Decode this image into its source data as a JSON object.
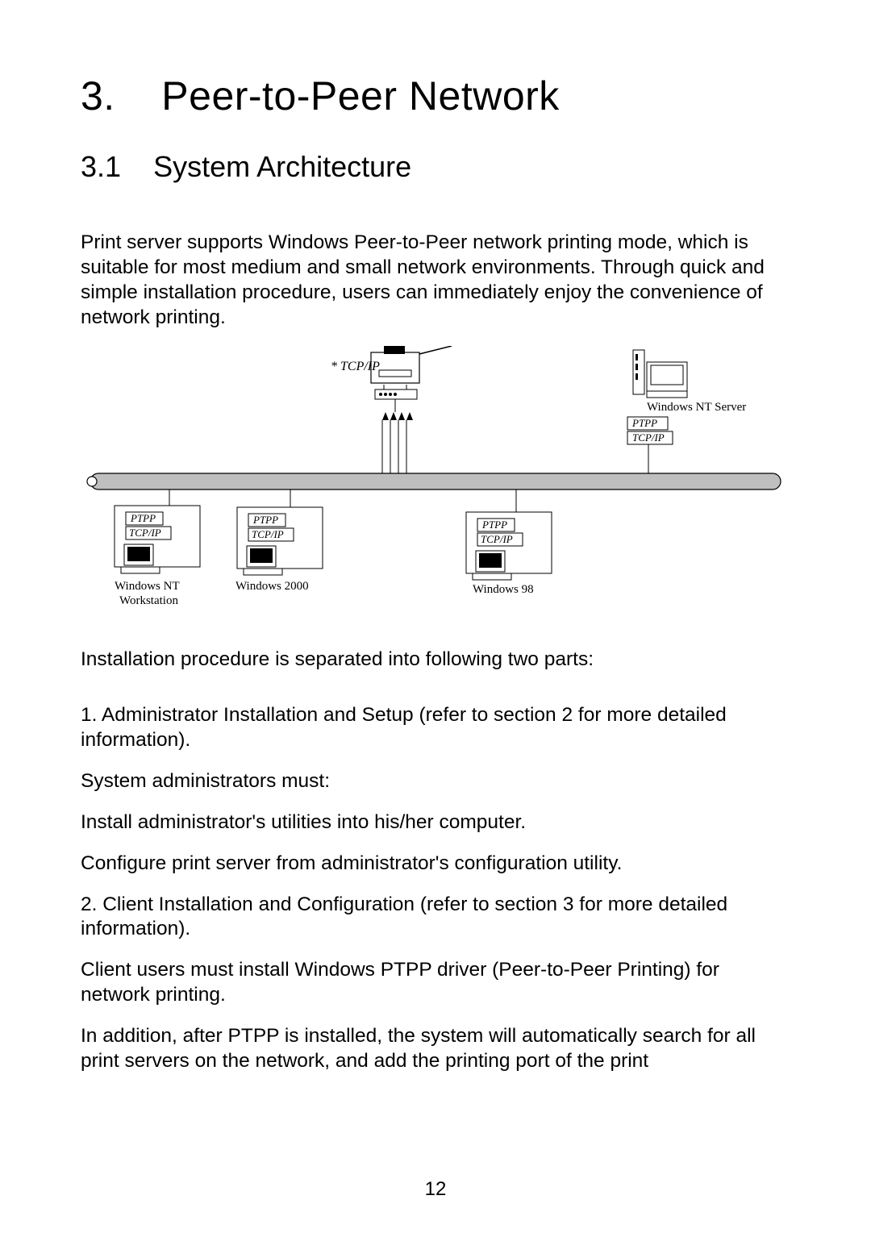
{
  "chapter": {
    "number": "3.",
    "title": "Peer-to-Peer Network"
  },
  "section": {
    "number": "3.1",
    "title": "System Architecture"
  },
  "paragraphs": {
    "intro": "Print server supports Windows Peer-to-Peer network printing mode, which is suitable for most medium and small network environments. Through quick and simple installation procedure, users can immediately enjoy the convenience of network printing.",
    "separated": "Installation procedure is separated into following two parts:",
    "item1": "1.  Administrator Installation and Setup (refer to section 2 for more detailed information).",
    "admins_must": "System administrators must:",
    "install_admin": "Install administrator's utilities into his/her computer.",
    "configure_ps": "Configure print server from administrator's configuration utility.",
    "item2": " 2.  Client Installation and Configuration (refer to section 3 for more detailed information).",
    "client_must": "Client users must install Windows PTPP driver (Peer-to-Peer Printing) for network printing.",
    "in_addition": "In addition, after PTPP is installed, the system will automatically search for all print servers on the network, and add the printing port of the print"
  },
  "diagram": {
    "printer_label": "* TCP/IP",
    "nt_server": "Windows NT Server",
    "ptpp": "PTPP",
    "tcpip": "TCP/IP",
    "nt_workstation_line1": "Windows NT",
    "nt_workstation_line2": "Workstation",
    "win2000": "Windows 2000",
    "win98": "Windows 98"
  },
  "page_number": "12"
}
